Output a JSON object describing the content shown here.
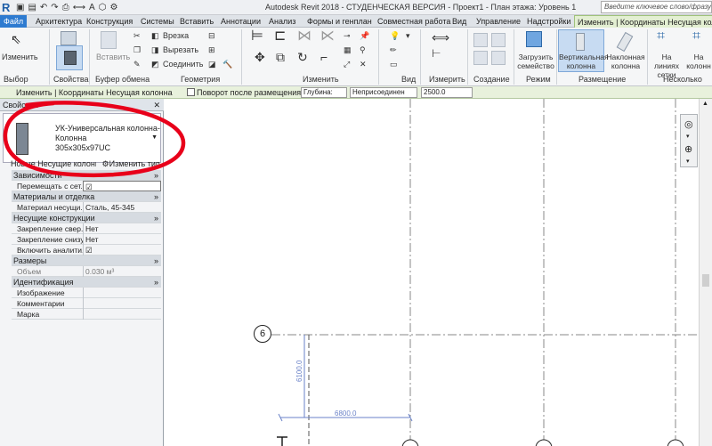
{
  "app": {
    "title": "Autodesk Revit 2018 - СТУДЕНЧЕСКАЯ ВЕРСИЯ - Проект1 - План этажа: Уровень 1",
    "search_placeholder": "Введите ключевое слово/фразу"
  },
  "tabs": [
    "Файл",
    "Архитектура",
    "Конструкция",
    "Системы",
    "Вставить",
    "Аннотации",
    "Анализ",
    "Формы и генплан",
    "Совместная работа",
    "Вид",
    "Управление",
    "Надстройки",
    "Изменить | Координаты Несущая колонна"
  ],
  "ribbon": {
    "modify_label": "Изменить",
    "properties_label": "Свойства",
    "paste_label": "Вставить",
    "cut_label": "Врезка",
    "cut2_label": "Вырезать",
    "join_label": "Соединить",
    "measure_label": "Измерить",
    "load_family_label": "Загрузить семейство",
    "vertical_column_label": "Вертикальная колонна",
    "slanted_column_label": "Наклонная колонна",
    "on_grids_label": "На линиях сетки",
    "at_columns_label": "На колонн",
    "panels": {
      "select": "Выбор",
      "properties": "Свойства",
      "clipboard": "Буфер обмена",
      "geometry": "Геометрия",
      "modify": "Изменить",
      "view": "Вид",
      "measure": "Измерить",
      "create": "Создание",
      "mode": "Режим",
      "placement": "Размещение",
      "multiple": "Несколько"
    }
  },
  "options_bar": {
    "context": "Изменить | Координаты Несущая колонна",
    "rotate_label": "Поворот после размещения",
    "depth_label": "Глубина:",
    "level_value": "Неприсоединен",
    "offset_value": "2500.0"
  },
  "properties": {
    "header": "Свойства",
    "close": "✕",
    "type_name_1": "УК-Универсальная колонна-",
    "type_name_2": "Колонна",
    "type_name_3": "305x305x97UC",
    "filter_label": "Новые Несущие колонны",
    "edit_type_label": "Изменить тип",
    "categories": [
      {
        "name": "Зависимости",
        "rows": [
          {
            "k": "Перемещать с сет...",
            "v": "☑"
          }
        ]
      },
      {
        "name": "Материалы и отделка",
        "rows": [
          {
            "k": "Материал несущи...",
            "v": "Сталь, 45-345"
          }
        ]
      },
      {
        "name": "Несущие конструкции",
        "rows": [
          {
            "k": "Закрепление свер...",
            "v": "Нет"
          },
          {
            "k": "Закрепление снизу",
            "v": "Нет"
          },
          {
            "k": "Включить аналити...",
            "v": "☑"
          }
        ]
      },
      {
        "name": "Размеры",
        "rows": [
          {
            "k": "Объем",
            "v": "0.030 м³"
          }
        ]
      },
      {
        "name": "Идентификация",
        "rows": [
          {
            "k": "Изображение",
            "v": ""
          },
          {
            "k": "Комментарии",
            "v": ""
          },
          {
            "k": "Марка",
            "v": ""
          }
        ]
      }
    ]
  },
  "canvas": {
    "grid_bubble": "6",
    "dim_h": "6800.0",
    "dim_v": "6100.0"
  },
  "colors": {
    "accent": "#2e7bd0",
    "context_tab": "#e3efd2",
    "annotation": "#e8001a"
  }
}
